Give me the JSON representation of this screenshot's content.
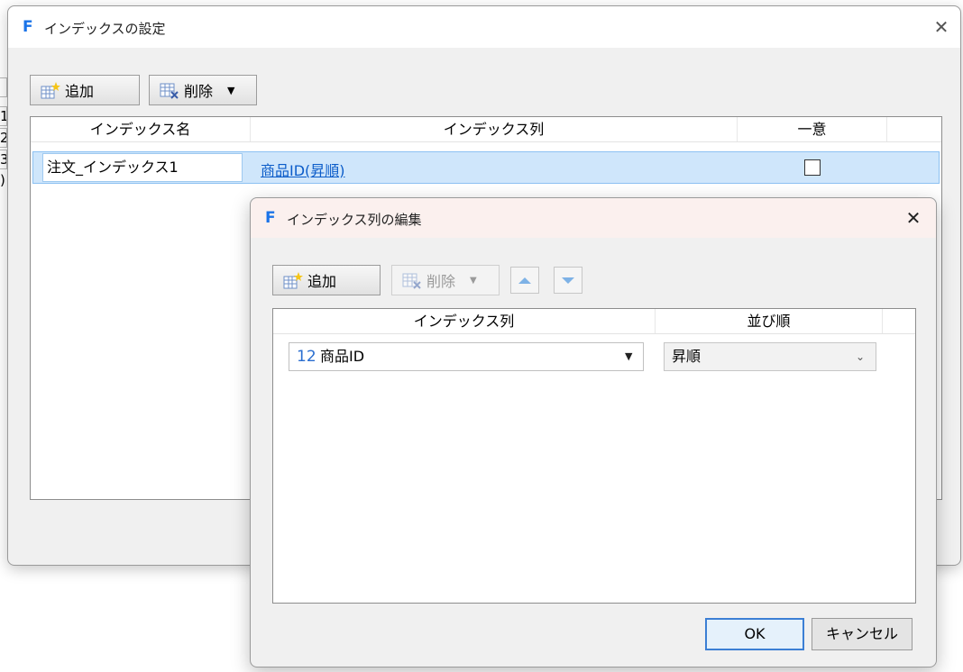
{
  "background": {
    "row_numbers": [
      "1",
      "2",
      "3",
      ")"
    ]
  },
  "main_dialog": {
    "title": "インデックスの設定",
    "logo_letter": "F",
    "close_glyph": "✕",
    "toolbar": {
      "add_label": "追加",
      "delete_label": "削除"
    },
    "grid": {
      "columns": [
        "インデックス名",
        "インデックス列",
        "一意"
      ],
      "rows": [
        {
          "name": "注文_インデックス1",
          "columns_value": "商品ID(昇順)",
          "unique": false
        }
      ]
    }
  },
  "edit_dialog": {
    "title": "インデックス列の編集",
    "logo_letter": "F",
    "close_glyph": "✕",
    "toolbar": {
      "add_label": "追加",
      "delete_label": "削除"
    },
    "grid": {
      "columns": [
        "インデックス列",
        "並び順"
      ],
      "rows": [
        {
          "type_icon": "12",
          "column": "商品ID",
          "order": "昇順"
        }
      ]
    },
    "ok_label": "OK",
    "cancel_label": "キャンセル"
  },
  "colors": {
    "accent": "#1a73e8",
    "selection": "#cfe6fb",
    "link": "#0b5cc9"
  }
}
